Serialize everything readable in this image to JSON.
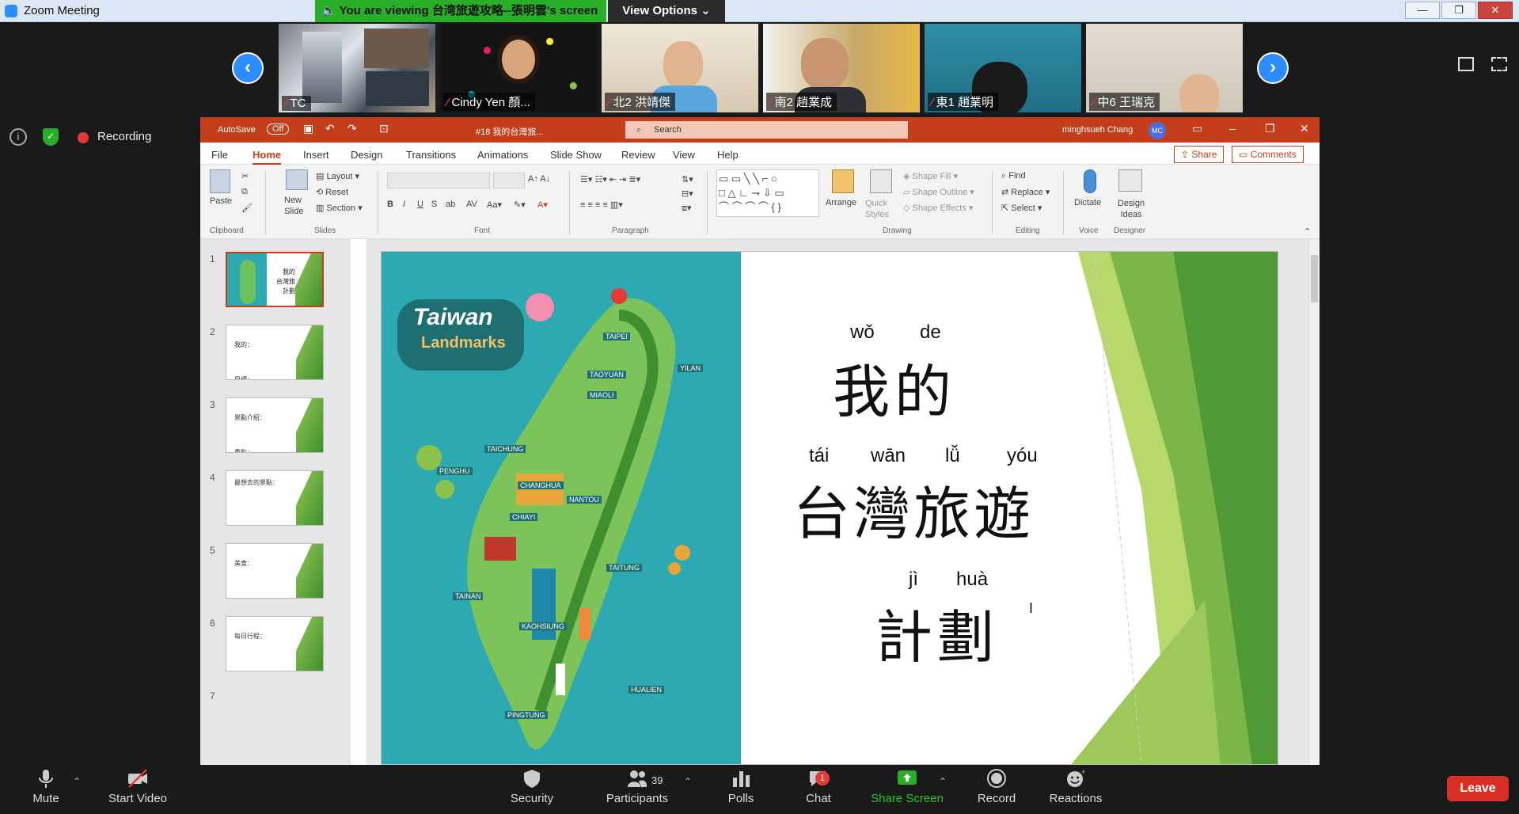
{
  "window": {
    "title": "Zoom Meeting",
    "controls": [
      "—",
      "❐",
      "✕"
    ]
  },
  "share_banner": {
    "text": "You are viewing 台湾旅遊攻略--張明雲's screen",
    "view_options": "View Options"
  },
  "participants_tiles": [
    {
      "name": "TC"
    },
    {
      "name": "Cindy Yen 顏..."
    },
    {
      "name": "北2 洪靖傑"
    },
    {
      "name": "南2 趙業成"
    },
    {
      "name": "東1 趙業明"
    },
    {
      "name": "中6 王瑞克"
    }
  ],
  "status": {
    "recording_label": "Recording"
  },
  "powerpoint": {
    "autosave": "AutoSave",
    "autosave_state": "Off",
    "doc_title": "#18 我的台灣旅...",
    "search_placeholder": "Search",
    "user_name": "minghsueh Chang",
    "user_initials": "MC",
    "tabs": [
      "File",
      "Home",
      "Insert",
      "Design",
      "Transitions",
      "Animations",
      "Slide Show",
      "Review",
      "View",
      "Help"
    ],
    "share_label": "Share",
    "comments_label": "Comments",
    "ribbon": {
      "paste": "Paste",
      "new_slide": "New Slide",
      "layout": "Layout",
      "reset": "Reset",
      "section": "Section",
      "groups": [
        "Clipboard",
        "Slides",
        "Font",
        "Paragraph",
        "Drawing",
        "Editing",
        "Voice",
        "Designer"
      ],
      "arrange": "Arrange",
      "quick_styles": "Quick Styles",
      "shape_fill": "Shape Fill",
      "shape_outline": "Shape Outline",
      "shape_effects": "Shape Effects",
      "find": "Find",
      "replace": "Replace",
      "select": "Select",
      "dictate": "Dictate",
      "design_ideas": "Design Ideas"
    },
    "thumbnails": [
      {
        "num": "1",
        "text": ""
      },
      {
        "num": "2",
        "text": "我的：\n\n目標："
      },
      {
        "num": "3",
        "text": "景點介紹：\n\n重點："
      },
      {
        "num": "4",
        "text": "最想去的景點："
      },
      {
        "num": "5",
        "text": "美食："
      },
      {
        "num": "6",
        "text": "每日行程："
      },
      {
        "num": "7",
        "text": ""
      }
    ],
    "slide": {
      "map_title_1": "Taiwan",
      "map_title_2": "Landmarks",
      "map_cities": [
        "TAIPEI",
        "TAOYUAN",
        "YILAN",
        "MIAOLI",
        "TAICHUNG",
        "CHANGHUA",
        "NANTOU",
        "PENGHU",
        "CHIAYI",
        "TAINAN",
        "KAOHSIUNG",
        "TAITUNG",
        "PINGTUNG",
        "HUALIEN"
      ],
      "line1_pinyin": [
        "wǒ",
        "de"
      ],
      "line1": "我的",
      "line2_pinyin": [
        "tái",
        "wān",
        "lǚ",
        "yóu"
      ],
      "line2": "台灣旅遊",
      "line3_pinyin": [
        "jì",
        "huà"
      ],
      "line3": "計劃"
    }
  },
  "toolbar": {
    "mute": "Mute",
    "start_video": "Start Video",
    "security": "Security",
    "participants": "Participants",
    "participants_count": "39",
    "polls": "Polls",
    "chat": "Chat",
    "chat_badge": "1",
    "share_screen": "Share Screen",
    "record": "Record",
    "reactions": "Reactions",
    "leave": "Leave"
  },
  "colors": {
    "zoom_blue": "#2d8cff",
    "ppt_red": "#c43e1c",
    "share_green": "#27b027",
    "leave_red": "#d93025"
  }
}
